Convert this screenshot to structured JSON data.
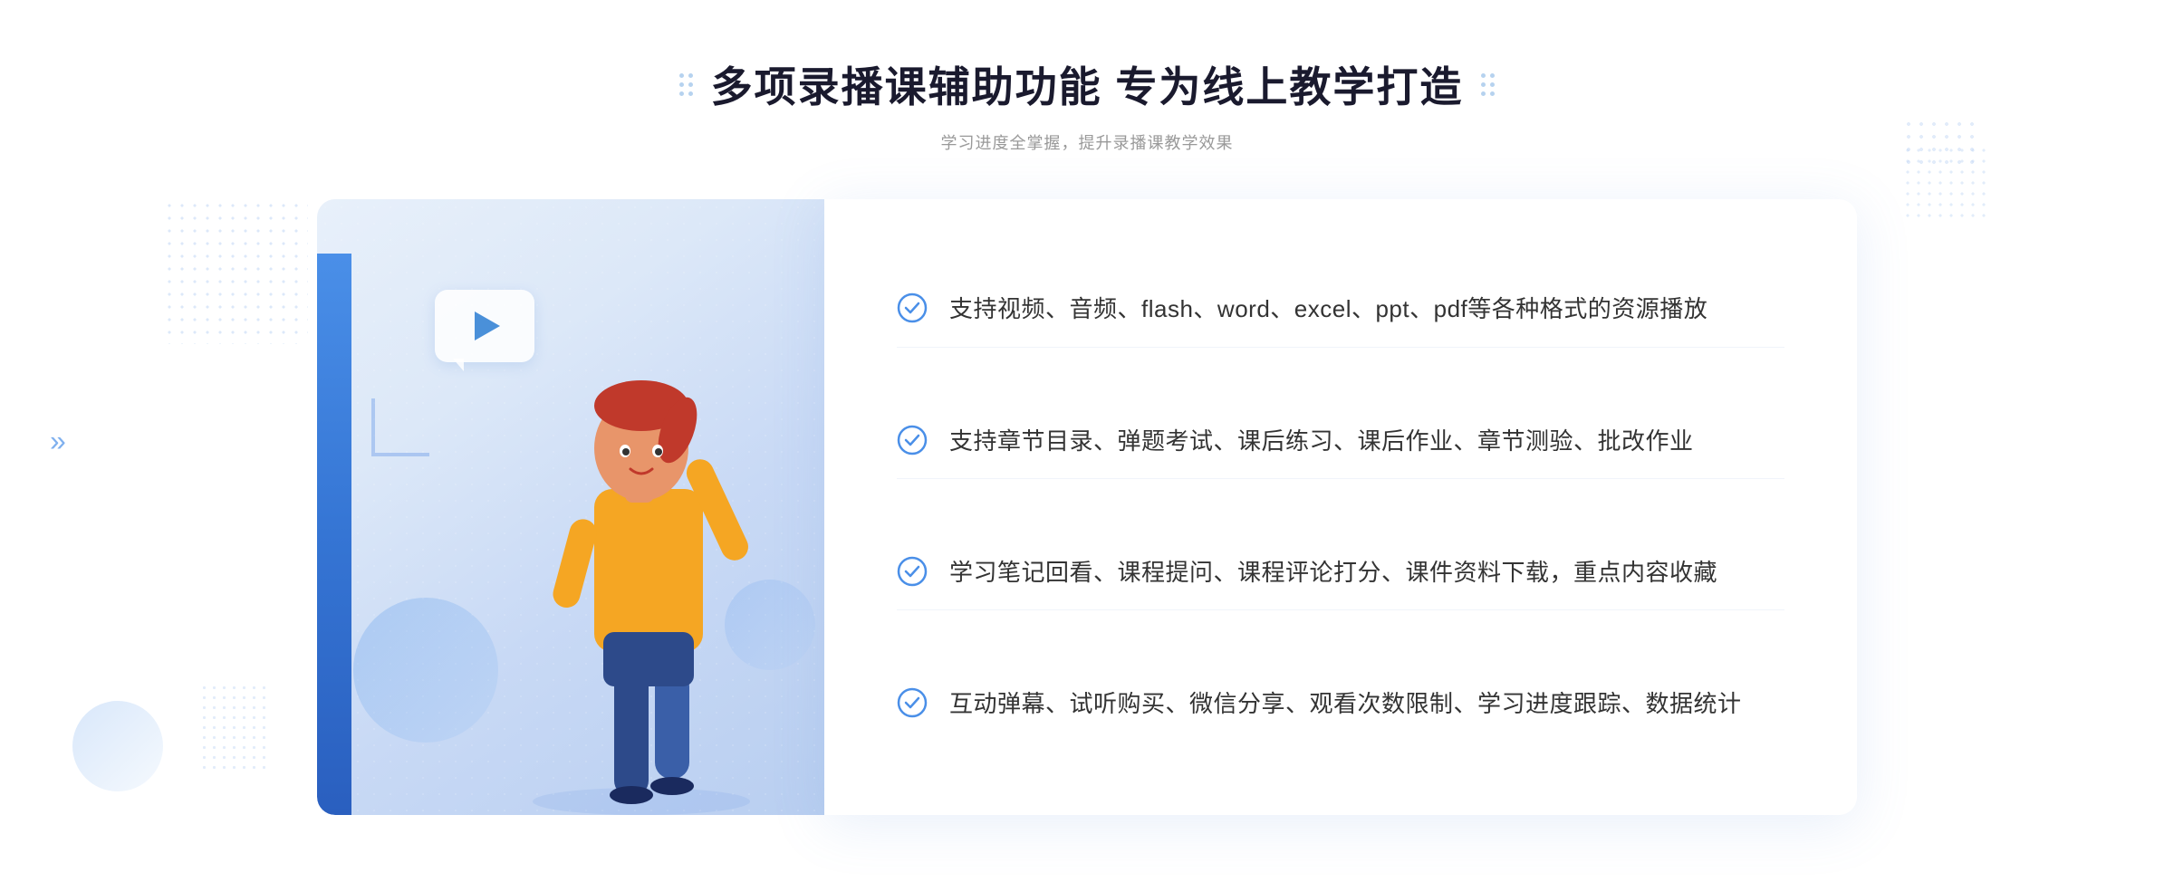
{
  "header": {
    "title": "多项录播课辅助功能 专为线上教学打造",
    "subtitle": "学习进度全掌握，提升录播课教学效果"
  },
  "features": [
    {
      "id": 1,
      "text": "支持视频、音频、flash、word、excel、ppt、pdf等各种格式的资源播放"
    },
    {
      "id": 2,
      "text": "支持章节目录、弹题考试、课后练习、课后作业、章节测验、批改作业"
    },
    {
      "id": 3,
      "text": "学习笔记回看、课程提问、课程评论打分、课件资料下载，重点内容收藏"
    },
    {
      "id": 4,
      "text": "互动弹幕、试听购买、微信分享、观看次数限制、学习进度跟踪、数据统计"
    }
  ],
  "colors": {
    "primary": "#4a8fe8",
    "primary_dark": "#3575d4",
    "title_color": "#1a1a2e",
    "text_color": "#333333",
    "subtitle_color": "#999999",
    "check_color": "#4a8fe8"
  },
  "icons": {
    "check": "check-circle",
    "play": "play-triangle",
    "arrow_left": "«",
    "dots_label": "decorative-dots"
  }
}
